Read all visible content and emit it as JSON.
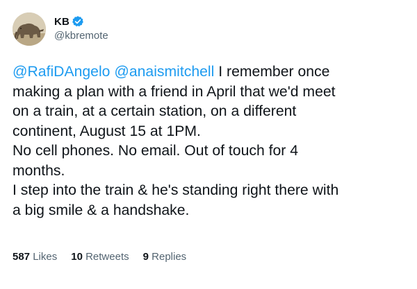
{
  "author": {
    "display_name": "KB",
    "handle": "@kbremote",
    "verified": true,
    "avatar_icon": "elephant-photo-avatar",
    "verified_color": "#1d9bf0"
  },
  "tweet": {
    "mentions": [
      "@RafiDAngelo",
      "@anaismitchell"
    ],
    "lines": [
      "I remember once",
      "making a plan with a friend in April that we'd meet",
      "on a train, at a certain station, on a different",
      "continent, August 15 at 1PM.",
      "No cell phones. No email. Out of touch for 4",
      "months.",
      "I step into the train & he's standing right there with",
      "a big smile & a handshake."
    ]
  },
  "stats": {
    "likes_count": "587",
    "likes_label": "Likes",
    "retweets_count": "10",
    "retweets_label": "Retweets",
    "replies_count": "9",
    "replies_label": "Replies"
  },
  "colors": {
    "link": "#1d9bf0",
    "text": "#0f1419",
    "secondary": "#536471"
  }
}
